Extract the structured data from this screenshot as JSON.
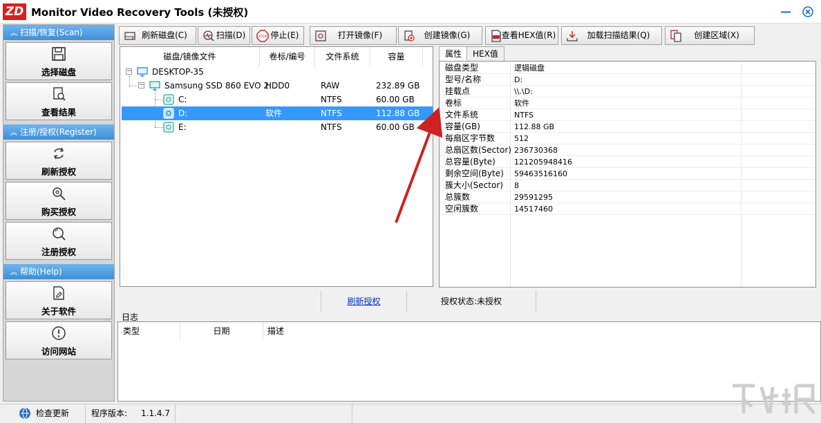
{
  "app": {
    "logo": "ZD",
    "title": "Monitor Video Recovery Tools (未授权)"
  },
  "sidebar": {
    "sections": [
      {
        "header": "扫描/恢复(Scan)",
        "buttons": [
          "选择磁盘",
          "查看结果"
        ]
      },
      {
        "header": "注册/授权(Register)",
        "buttons": [
          "刷新授权",
          "购买授权",
          "注册授权"
        ]
      },
      {
        "header": "帮助(Help)",
        "buttons": [
          "关于软件",
          "访问网站"
        ]
      }
    ]
  },
  "toolbar": {
    "refresh_disk": "刷新磁盘(C)",
    "scan": "扫描(D)",
    "stop": "停止(E)",
    "open_image": "打开镜像(F)",
    "create_image": "创建镜像(G)",
    "view_hex": "查看HEX值(R)",
    "load_scan": "加载扫描结果(Q)",
    "create_region": "创建区域(X)"
  },
  "disk_table": {
    "columns": [
      "磁盘/镜像文件",
      "卷标/编号",
      "文件系统",
      "容量"
    ],
    "rows": [
      {
        "name": "DESKTOP-35",
        "label": "",
        "fs": "",
        "size": ""
      },
      {
        "name": "Samsung SSD 860 EVO 2...",
        "label": "HDD0",
        "fs": "RAW",
        "size": "232.89 GB"
      },
      {
        "name": "C:",
        "label": "",
        "fs": "NTFS",
        "size": "60.00 GB"
      },
      {
        "name": "D:",
        "label": "软件",
        "fs": "NTFS",
        "size": "112.88 GB"
      },
      {
        "name": "E:",
        "label": "",
        "fs": "NTFS",
        "size": "60.00 GB"
      }
    ]
  },
  "props": {
    "tabs": [
      "属性",
      "HEX值"
    ],
    "rows": [
      {
        "k": "磁盘类型",
        "v": "逻辑磁盘"
      },
      {
        "k": "型号/名称",
        "v": "D:"
      },
      {
        "k": "挂载点",
        "v": "\\\\.\\D:"
      },
      {
        "k": "卷标",
        "v": "软件"
      },
      {
        "k": "文件系统",
        "v": "NTFS"
      },
      {
        "k": "容量(GB)",
        "v": "112.88 GB"
      },
      {
        "k": "每扇区字节数",
        "v": "512"
      },
      {
        "k": "总扇区数(Sector)",
        "v": "236730368"
      },
      {
        "k": "总容量(Byte)",
        "v": "121205948416"
      },
      {
        "k": "剩余空间(Byte)",
        "v": "59463516160"
      },
      {
        "k": "簇大小(Sector)",
        "v": "8"
      },
      {
        "k": "总簇数",
        "v": "29591295"
      },
      {
        "k": "空闲簇数",
        "v": "14517460"
      }
    ]
  },
  "register": {
    "link": "刷新授权",
    "status": "授权状态:未授权"
  },
  "log": {
    "label": "日志",
    "columns": [
      "类型",
      "日期",
      "描述"
    ]
  },
  "statusbar": {
    "check_update": "检查更新",
    "version_label": "程序版本:",
    "version": "1.1.4.7"
  },
  "colors": {
    "selection": "#3399ff",
    "sidebar_header": "#3c8fd8",
    "logo": "#d9201f",
    "arrow": "#cc2222"
  }
}
